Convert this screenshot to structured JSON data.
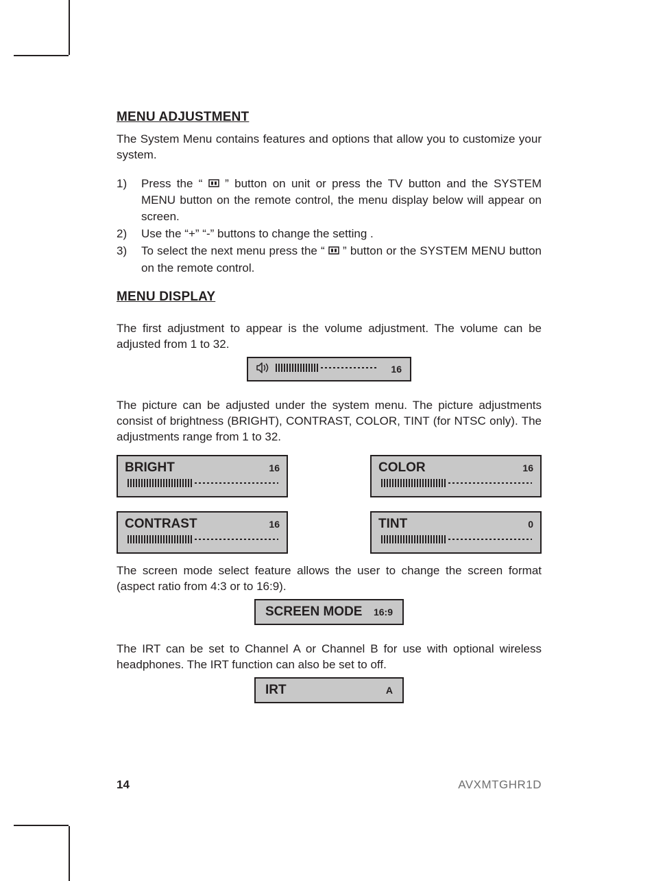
{
  "headings": {
    "menu_adjustment": "MENU ADJUSTMENT",
    "menu_display": "MENU DISPLAY"
  },
  "paragraphs": {
    "intro": "The System Menu contains features and options that allow you to customize your system.",
    "volume": "The first adjustment to appear is the volume adjustment. The volume can be adjusted from 1 to 32.",
    "picture": "The picture can be adjusted under the system menu. The picture adjustments consist of brightness (BRIGHT), CONTRAST, COLOR, TINT (for NTSC only). The adjustments range from 1 to 32.",
    "screen_mode": "The screen mode select feature allows the user to change the screen format (aspect ratio from 4:3 or to 16:9).",
    "irt": "The IRT can be set to Channel A or Channel B for use with optional wireless headphones. The IRT function can also be set to off."
  },
  "steps": {
    "s1_num": "1)",
    "s1_a": "Press the “ ",
    "s1_b": " ” button on unit or  press the TV button and the SYSTEM MENU button on the remote control, the menu display below will appear on screen.",
    "s2_num": "2)",
    "s2": "Use the “+”  “-” buttons  to change the setting .",
    "s3_num": "3)",
    "s3_a": "To select the next menu press  the “ ",
    "s3_b": " ” button or the SYSTEM MENU button on the remote control."
  },
  "osd": {
    "volume_value": "16",
    "bright_label": "BRIGHT",
    "bright_value": "16",
    "contrast_label": "CONTRAST",
    "contrast_value": "16",
    "color_label": "COLOR",
    "color_value": "16",
    "tint_label": "TINT",
    "tint_value": "0",
    "screen_mode_label": "SCREEN MODE",
    "screen_mode_value": "16:9",
    "irt_label": "IRT",
    "irt_value": "A"
  },
  "footer": {
    "page_number": "14",
    "model": "AVXMTGHR1D"
  }
}
